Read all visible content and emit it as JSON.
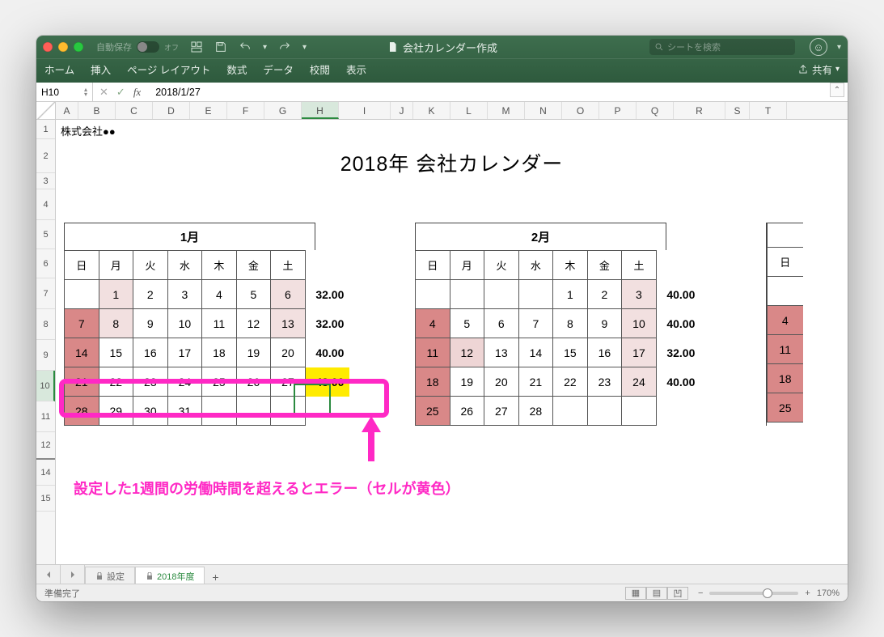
{
  "titlebar": {
    "autosave_label": "自動保存",
    "autosave_state": "オフ",
    "document_title": "会社カレンダー作成",
    "search_placeholder": "シートを検索",
    "menu": [
      "ホーム",
      "挿入",
      "ページ レイアウト",
      "数式",
      "データ",
      "校閲",
      "表示"
    ],
    "share_label": "共有"
  },
  "formula_bar": {
    "cell_ref": "H10",
    "formula": "2018/1/27"
  },
  "columns": [
    "A",
    "B",
    "C",
    "D",
    "E",
    "F",
    "G",
    "H",
    "I",
    "J",
    "K",
    "L",
    "M",
    "N",
    "O",
    "P",
    "Q",
    "R",
    "S",
    "T"
  ],
  "rows": [
    "1",
    "2",
    "3",
    "4",
    "5",
    "6",
    "7",
    "8",
    "9",
    "10",
    "11",
    "12",
    "14",
    "15"
  ],
  "sheet": {
    "company": "株式会社●●",
    "title": "2018年 会社カレンダー"
  },
  "months": {
    "jan": {
      "name": "1月",
      "dow": [
        "日",
        "月",
        "火",
        "水",
        "木",
        "金",
        "土"
      ],
      "rows": [
        {
          "days": [
            "",
            "1",
            "2",
            "3",
            "4",
            "5",
            "6"
          ],
          "hours": "32.00"
        },
        {
          "days": [
            "7",
            "8",
            "9",
            "10",
            "11",
            "12",
            "13"
          ],
          "hours": "32.00"
        },
        {
          "days": [
            "14",
            "15",
            "16",
            "17",
            "18",
            "19",
            "20"
          ],
          "hours": "40.00"
        },
        {
          "days": [
            "21",
            "22",
            "23",
            "24",
            "25",
            "26",
            "27"
          ],
          "hours": "48.00"
        },
        {
          "days": [
            "28",
            "29",
            "30",
            "31",
            "",
            "",
            ""
          ],
          "hours": ""
        }
      ]
    },
    "feb": {
      "name": "2月",
      "dow": [
        "日",
        "月",
        "火",
        "水",
        "木",
        "金",
        "土"
      ],
      "rows": [
        {
          "days": [
            "",
            "",
            "",
            "",
            "1",
            "2",
            "3"
          ],
          "hours": "40.00"
        },
        {
          "days": [
            "4",
            "5",
            "6",
            "7",
            "8",
            "9",
            "10"
          ],
          "hours": "40.00"
        },
        {
          "days": [
            "11",
            "12",
            "13",
            "14",
            "15",
            "16",
            "17"
          ],
          "hours": "32.00"
        },
        {
          "days": [
            "18",
            "19",
            "20",
            "21",
            "22",
            "23",
            "24"
          ],
          "hours": "40.00"
        },
        {
          "days": [
            "25",
            "26",
            "27",
            "28",
            "",
            "",
            ""
          ],
          "hours": ""
        }
      ]
    },
    "mar_partial": {
      "dow": [
        "日"
      ],
      "days": [
        "",
        "4",
        "11",
        "18",
        "25"
      ]
    }
  },
  "annotation_text": "設定した1週間の労働時間を超えるとエラー（セルが黄色）",
  "tabs": {
    "tab1": "設定",
    "tab2": "2018年度"
  },
  "status": {
    "ready": "準備完了",
    "zoom": "170%"
  }
}
